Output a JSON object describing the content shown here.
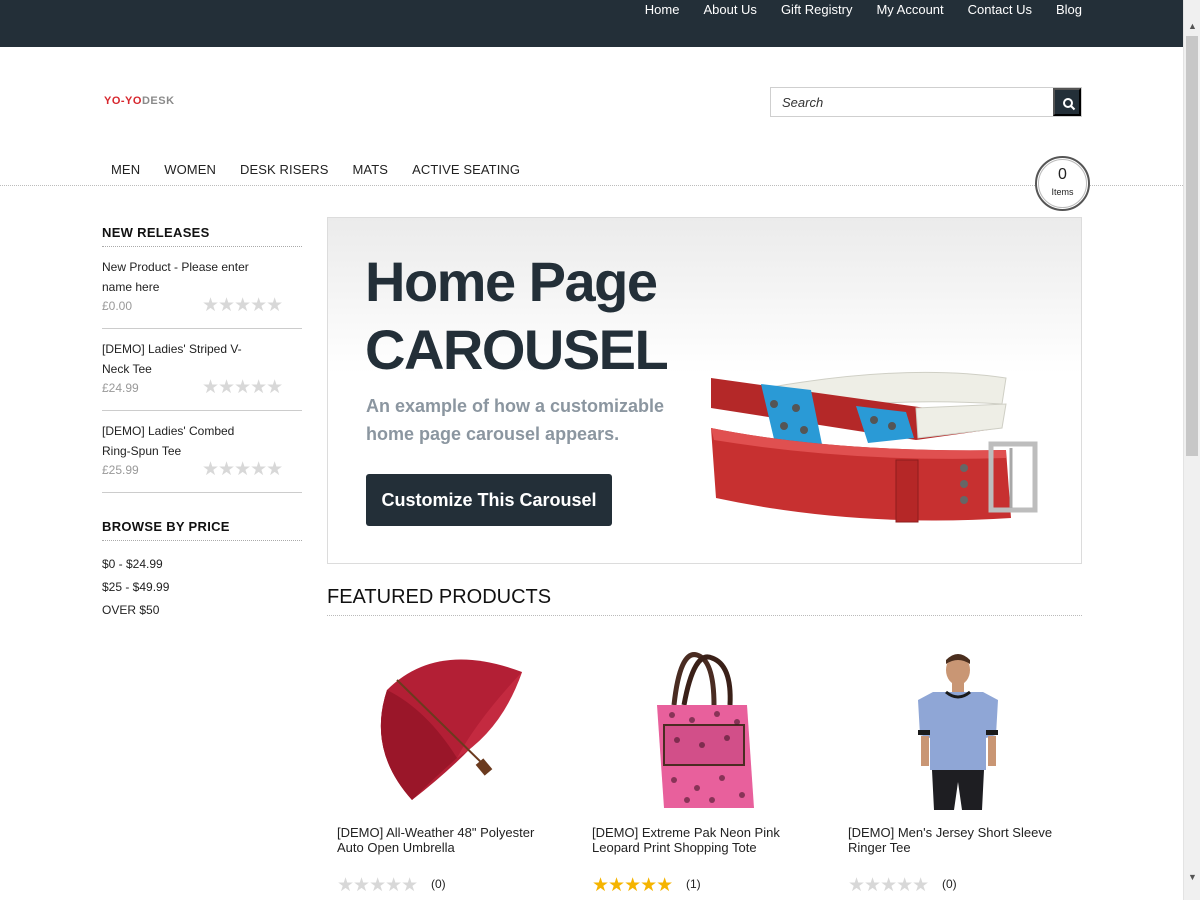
{
  "top_nav": [
    "Home",
    "About Us",
    "Gift Registry",
    "My Account",
    "Contact Us",
    "Blog"
  ],
  "logo": {
    "part1": "YO-YO",
    "part2": "DESK"
  },
  "search": {
    "placeholder": "Search"
  },
  "category_nav": [
    "MEN",
    "WOMEN",
    "DESK RISERS",
    "MATS",
    "ACTIVE SEATING"
  ],
  "cart": {
    "count": "0",
    "label": "Items"
  },
  "sidebar": {
    "new_releases": {
      "heading": "NEW RELEASES",
      "items": [
        {
          "name": "New Product - Please enter name here",
          "price": "£0.00",
          "stars": "★★★★★"
        },
        {
          "name": "[DEMO] Ladies' Striped V-Neck Tee",
          "price": "£24.99",
          "stars": "★★★★★"
        },
        {
          "name": "[DEMO] Ladies' Combed Ring-Spun Tee",
          "price": "£25.99",
          "stars": "★★★★★"
        }
      ]
    },
    "browse_by_price": {
      "heading": "BROWSE BY PRICE",
      "items": [
        "$0 - $24.99",
        "$25 - $49.99",
        "OVER $50"
      ]
    }
  },
  "carousel": {
    "title_line1": "Home Page",
    "title_line2": "CAROUSEL",
    "subtitle": "An example of how a customizable home page carousel appears.",
    "button": "Customize This Carousel"
  },
  "featured": {
    "heading": "FEATURED PRODUCTS",
    "products": [
      {
        "name": "[DEMO] All-Weather 48\" Polyester Auto Open Umbrella",
        "stars": "★★★★★",
        "count": "(0)",
        "image": "umbrella"
      },
      {
        "name": "[DEMO] Extreme Pak Neon Pink Leopard Print Shopping Tote",
        "stars": "★★★★★",
        "count": "(1)",
        "image": "tote-bag"
      },
      {
        "name": "[DEMO] Men's Jersey Short Sleeve Ringer Tee",
        "stars": "★★★★★",
        "count": "(0)",
        "image": "t-shirt"
      }
    ]
  },
  "colors": {
    "dark": "#232f38",
    "star_active": "#f5b400",
    "star_inactive": "#d8d8d8",
    "logo_red": "#d7262d"
  }
}
